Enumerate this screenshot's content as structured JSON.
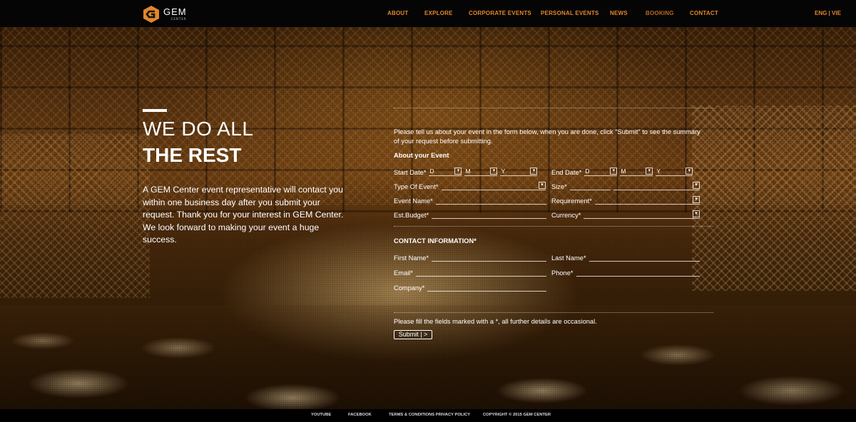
{
  "header": {
    "logo_name": "GEM",
    "logo_sub": "CENTER",
    "nav": [
      "ABOUT",
      "EXPLORE",
      "CORPORATE EVENTS",
      "PERSONAL EVENTS",
      "NEWS",
      "BOOKING",
      "CONTACT"
    ],
    "active_nav": "BOOKING",
    "lang": "ENG | VIE",
    "accent_color": "#e3862a"
  },
  "hero": {
    "line1": "WE DO ALL",
    "line2": "THE REST",
    "intro": "A GEM Center event representative will contact you within one business day after you submit your request. Thank you for your interest in GEM Center. We look forward to making your event a huge success."
  },
  "form": {
    "lead": "Please tell us about your event in the form below, when you are done, click \"Submit\" to see the summary of your request before submitting.",
    "about_title": "About your Event",
    "start_date_label": "Start Date*",
    "end_date_label": "End Date*",
    "date_parts": [
      "D",
      "M",
      "Y"
    ],
    "type_label": "Type Of Event*",
    "size_label": "Size*",
    "event_name_label": "Event Name*",
    "requirement_label": "Requirement*",
    "budget_label": "Est.Budget*",
    "currency_label": "Currency*",
    "contact_title": "CONTACT INFORMATION*",
    "first_name_label": "First Name*",
    "last_name_label": "Last Name*",
    "email_label": "Email*",
    "phone_label": "Phone*",
    "company_label": "Company*",
    "note": "Please fill the fields marked with a *, all further details are occasional.",
    "submit_label": "Submit | >"
  },
  "footer": {
    "youtube": "YOUTUBE",
    "facebook": "FACEBOOK",
    "terms": "TERMS & CONDITIONS PRIVACY POLICY",
    "copyright": "COPYRIGHT © 2015 GEM CENTER"
  }
}
